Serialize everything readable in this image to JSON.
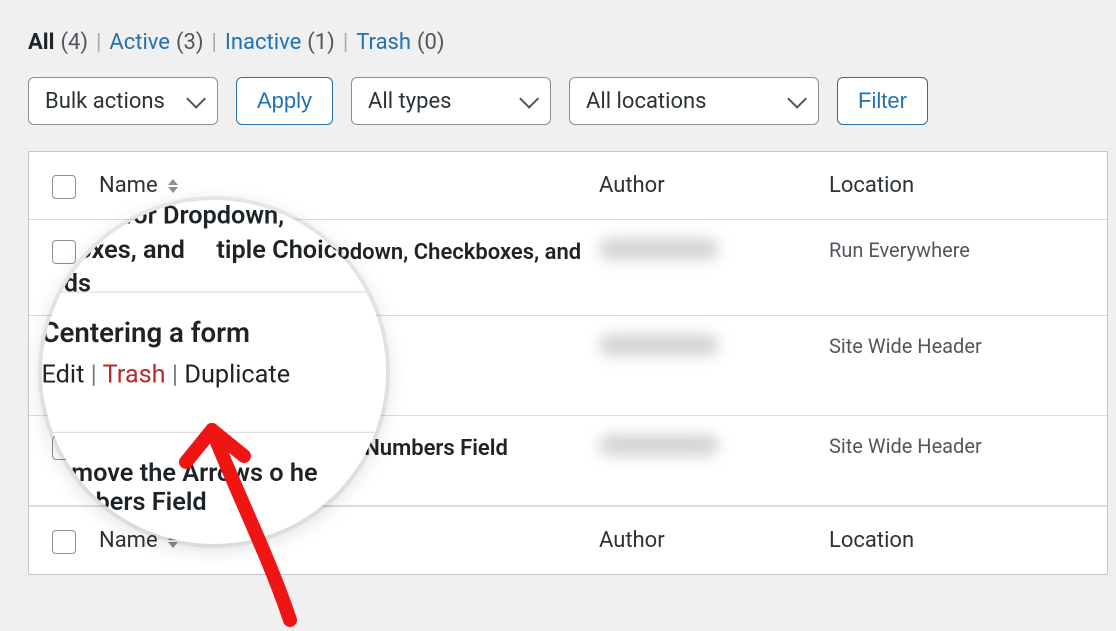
{
  "tabs": {
    "all": {
      "label": "All",
      "count": "(4)"
    },
    "active": {
      "label": "Active",
      "count": "(3)"
    },
    "inactive": {
      "label": "Inactive",
      "count": "(1)"
    },
    "trash": {
      "label": "Trash",
      "count": "(0)"
    }
  },
  "controls": {
    "bulk_label": "Bulk actions",
    "apply_label": "Apply",
    "types_label": "All types",
    "locations_label": "All locations",
    "filter_label": "Filter"
  },
  "columns": {
    "name": "Name",
    "author": "Author",
    "location": "Location"
  },
  "rows": [
    {
      "title": "Add Field Values for Dropdown, Checkboxes, and Multiple Choice Fields",
      "location": "Run Everywhere"
    },
    {
      "title": "Centering a form",
      "location": "Site Wide Header"
    },
    {
      "title": "Remove the Arrows on the Numbers Field",
      "location": "Site Wide Header"
    }
  ],
  "actions": {
    "edit": "Edit",
    "trash": "Trash",
    "duplicate": "Duplicate"
  },
  "magnifier": {
    "top_line1": "for Dropdown,",
    "top_line2_a": "eckboxes, and",
    "top_line2_b": "tiple Choice Fields",
    "mid_title": "Centering a form",
    "bot_line": "Remove the Arrows o   he Numbers Field"
  }
}
